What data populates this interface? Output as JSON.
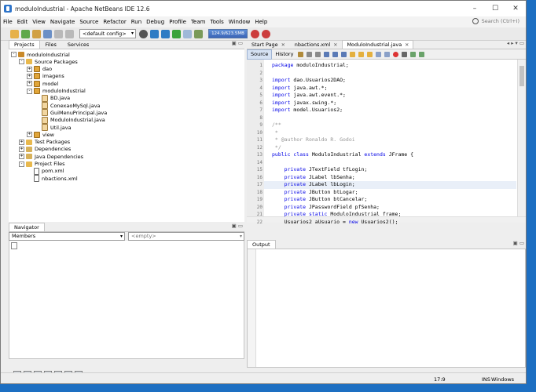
{
  "window": {
    "title": "moduloIndustrial - Apache NetBeans IDE 12.6",
    "controls": [
      "–",
      "☐",
      "✕"
    ]
  },
  "menu": {
    "items": [
      "File",
      "Edit",
      "View",
      "Navigate",
      "Source",
      "Refactor",
      "Run",
      "Debug",
      "Profile",
      "Team",
      "Tools",
      "Window",
      "Help"
    ],
    "search_placeholder": "Search (Ctrl+I)"
  },
  "toolbar": {
    "config": "<default config>",
    "memory": "124.9/623.5MB"
  },
  "left_panel": {
    "tabs": [
      "Projects",
      "Files",
      "Services"
    ],
    "tree": [
      {
        "label": "moduloIndustrial",
        "depth": 0,
        "icon": "proj",
        "exp": "-"
      },
      {
        "label": "Source Packages",
        "depth": 1,
        "icon": "fold",
        "exp": "-"
      },
      {
        "label": "dao",
        "depth": 2,
        "icon": "pkg",
        "exp": "+"
      },
      {
        "label": "imagens",
        "depth": 2,
        "icon": "pkg",
        "exp": "+"
      },
      {
        "label": "model",
        "depth": 2,
        "icon": "pkg",
        "exp": "+"
      },
      {
        "label": "moduloIndustrial",
        "depth": 2,
        "icon": "pkg",
        "exp": "-"
      },
      {
        "label": "BD.java",
        "depth": 3,
        "icon": "java",
        "exp": ""
      },
      {
        "label": "ConexaoMySql.java",
        "depth": 3,
        "icon": "java",
        "exp": ""
      },
      {
        "label": "GuiMenuPrincipal.java",
        "depth": 3,
        "icon": "java",
        "exp": ""
      },
      {
        "label": "ModuloIndustrial.java",
        "depth": 3,
        "icon": "java",
        "exp": ""
      },
      {
        "label": "Util.java",
        "depth": 3,
        "icon": "java",
        "exp": ""
      },
      {
        "label": "view",
        "depth": 2,
        "icon": "pkg",
        "exp": "+"
      },
      {
        "label": "Test Packages",
        "depth": 1,
        "icon": "fold",
        "exp": "+"
      },
      {
        "label": "Dependencies",
        "depth": 1,
        "icon": "lib",
        "exp": "+"
      },
      {
        "label": "Java Dependencies",
        "depth": 1,
        "icon": "lib",
        "exp": "+"
      },
      {
        "label": "Project Files",
        "depth": 1,
        "icon": "fold",
        "exp": "-"
      },
      {
        "label": "pom.xml",
        "depth": 2,
        "icon": "file",
        "exp": ""
      },
      {
        "label": "nbactions.xml",
        "depth": 2,
        "icon": "file",
        "exp": ""
      }
    ]
  },
  "navigator": {
    "tab": "Navigator",
    "members_label": "Members",
    "empty_label": "<empty>"
  },
  "editor": {
    "tabs": [
      "Start Page",
      "nbactions.xml",
      "ModuloIndustrial.java"
    ],
    "active_tab": 2,
    "source_btn": "Source",
    "history_btn": "History",
    "highlight_line": 17,
    "lines": [
      [
        [
          "kw",
          "package "
        ],
        [
          "",
          "moduloIndustrial;"
        ]
      ],
      [],
      [
        [
          "kw",
          "import "
        ],
        [
          "",
          "dao.Usuarios2DAO;"
        ]
      ],
      [
        [
          "kw",
          "import "
        ],
        [
          "",
          "java.awt.*;"
        ]
      ],
      [
        [
          "kw",
          "import "
        ],
        [
          "",
          "java.awt.event.*;"
        ]
      ],
      [
        [
          "kw",
          "import "
        ],
        [
          "",
          "javax.swing.*;"
        ]
      ],
      [
        [
          "kw",
          "import "
        ],
        [
          "",
          "model.Usuarios2;"
        ]
      ],
      [],
      [
        [
          "cm",
          "/**"
        ]
      ],
      [
        [
          "cm",
          " *"
        ]
      ],
      [
        [
          "cm",
          " * @author Ronaldo R. Godoi"
        ]
      ],
      [
        [
          "cm",
          " */"
        ]
      ],
      [
        [
          "kw",
          "public class "
        ],
        [
          "",
          "ModuloIndustrial "
        ],
        [
          "kw",
          "extends "
        ],
        [
          "",
          "JFrame {"
        ]
      ],
      [],
      [
        [
          "kw",
          "    private "
        ],
        [
          "",
          "JTextField tfLogin;"
        ]
      ],
      [
        [
          "kw",
          "    private "
        ],
        [
          "",
          "JLabel lbSenha;"
        ]
      ],
      [
        [
          "kw",
          "    private "
        ],
        [
          "",
          "JLabel lbLogin;"
        ]
      ],
      [
        [
          "kw",
          "    private "
        ],
        [
          "",
          "JButton btLogar;"
        ]
      ],
      [
        [
          "kw",
          "    private "
        ],
        [
          "",
          "JButton btCancelar;"
        ]
      ],
      [
        [
          "kw",
          "    private "
        ],
        [
          "",
          "JPasswordField pfSenha;"
        ]
      ],
      [
        [
          "kw",
          "    private static "
        ],
        [
          "",
          "ModuloIndustrial frame;"
        ]
      ],
      [
        [
          "",
          "    Usuarios2 aUsuario = "
        ],
        [
          "kw",
          "new "
        ],
        [
          "",
          "Usuarios2();"
        ]
      ]
    ]
  },
  "output": {
    "tab": "Output"
  },
  "status": {
    "position": "17:9",
    "mode": "INS",
    "eol": "Windows (CRLF)"
  }
}
